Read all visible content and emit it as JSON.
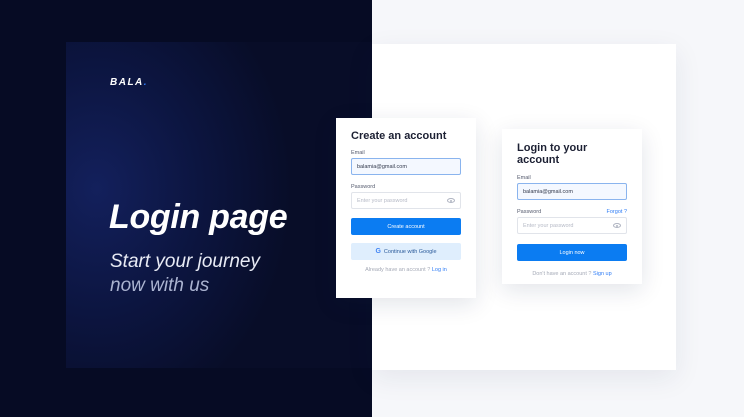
{
  "brand": {
    "name": "BALA",
    "dot": "."
  },
  "hero": {
    "title": "Login page",
    "tagline_line1": "Start your journey",
    "tagline_line2": "now with us"
  },
  "signup": {
    "title": "Create an account",
    "email_label": "Email",
    "email_value": "balamia@gmail.com",
    "password_label": "Password",
    "password_placeholder": "Enter your password",
    "submit_label": "Create account",
    "google_label": "Continue with Google",
    "footer_text": "Already have an account ?",
    "footer_link": "Log in"
  },
  "login": {
    "title": "Login to your account",
    "email_label": "Email",
    "email_value": "balamia@gmail.com",
    "password_label": "Password",
    "forgot_label": "Forgot ?",
    "password_placeholder": "Enter your password",
    "submit_label": "Login now",
    "footer_text": "Don't have an account ?",
    "footer_link": "Sign up"
  },
  "colors": {
    "dark_bg": "#060b24",
    "accent": "#0b7cf2",
    "light_bg": "#f6f7fa"
  },
  "icons": {
    "google": "google-icon",
    "eye": "eye-icon"
  }
}
